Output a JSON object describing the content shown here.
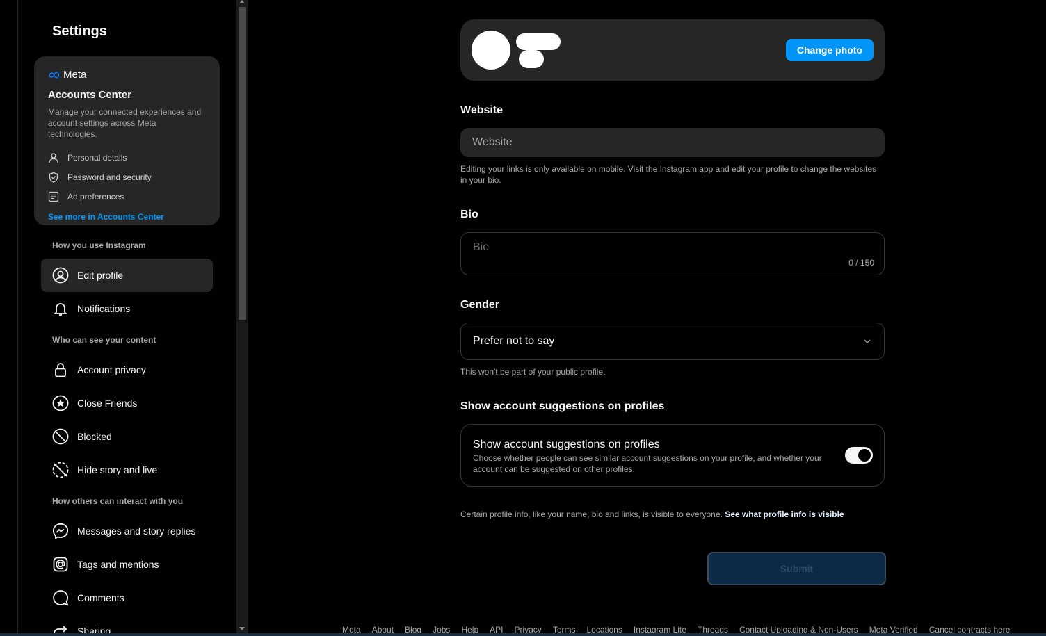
{
  "sidebar": {
    "title": "Settings",
    "accounts_center": {
      "brand": "Meta",
      "title": "Accounts Center",
      "description": "Manage your connected experiences and account settings across Meta technologies.",
      "items": [
        {
          "label": "Personal details",
          "icon": "person-icon"
        },
        {
          "label": "Password and security",
          "icon": "shield-check-icon"
        },
        {
          "label": "Ad preferences",
          "icon": "ad-icon"
        }
      ],
      "see_more": "See more in Accounts Center"
    },
    "sections": [
      {
        "label": "How you use Instagram"
      },
      {
        "label": "Who can see your content"
      },
      {
        "label": "How others can interact with you"
      }
    ],
    "nav": [
      {
        "label": "Edit profile",
        "icon": "user-circle-icon",
        "active": true
      },
      {
        "label": "Notifications",
        "icon": "bell-icon"
      },
      {
        "label": "Account privacy",
        "icon": "lock-icon"
      },
      {
        "label": "Close Friends",
        "icon": "star-circle-icon"
      },
      {
        "label": "Blocked",
        "icon": "blocked-icon"
      },
      {
        "label": "Hide story and live",
        "icon": "hide-story-icon"
      },
      {
        "label": "Messages and story replies",
        "icon": "messenger-icon"
      },
      {
        "label": "Tags and mentions",
        "icon": "at-icon"
      },
      {
        "label": "Comments",
        "icon": "comment-icon"
      },
      {
        "label": "Sharing",
        "icon": "share-icon"
      }
    ]
  },
  "profile": {
    "change_photo": "Change photo"
  },
  "website": {
    "label": "Website",
    "placeholder": "Website",
    "help": "Editing your links is only available on mobile. Visit the Instagram app and edit your profile to change the websites in your bio."
  },
  "bio": {
    "label": "Bio",
    "placeholder": "Bio",
    "count": "0 / 150"
  },
  "gender": {
    "label": "Gender",
    "value": "Prefer not to say",
    "help": "This won't be part of your public profile."
  },
  "suggestions": {
    "label": "Show account suggestions on profiles",
    "title": "Show account suggestions on profiles",
    "description": "Choose whether people can see similar account suggestions on your profile, and whether your account can be suggested on other profiles.",
    "enabled": true
  },
  "visibility_note": {
    "text": "Certain profile info, like your name, bio and links, is visible to everyone.",
    "link": "See what profile info is visible"
  },
  "submit_label": "Submit",
  "footer": [
    "Meta",
    "About",
    "Blog",
    "Jobs",
    "Help",
    "API",
    "Privacy",
    "Terms",
    "Locations",
    "Instagram Lite",
    "Threads",
    "Contact Uploading & Non-Users",
    "Meta Verified",
    "Cancel contracts here"
  ],
  "colors": {
    "accent": "#0095f6",
    "background": "#000000",
    "card": "#262626"
  }
}
